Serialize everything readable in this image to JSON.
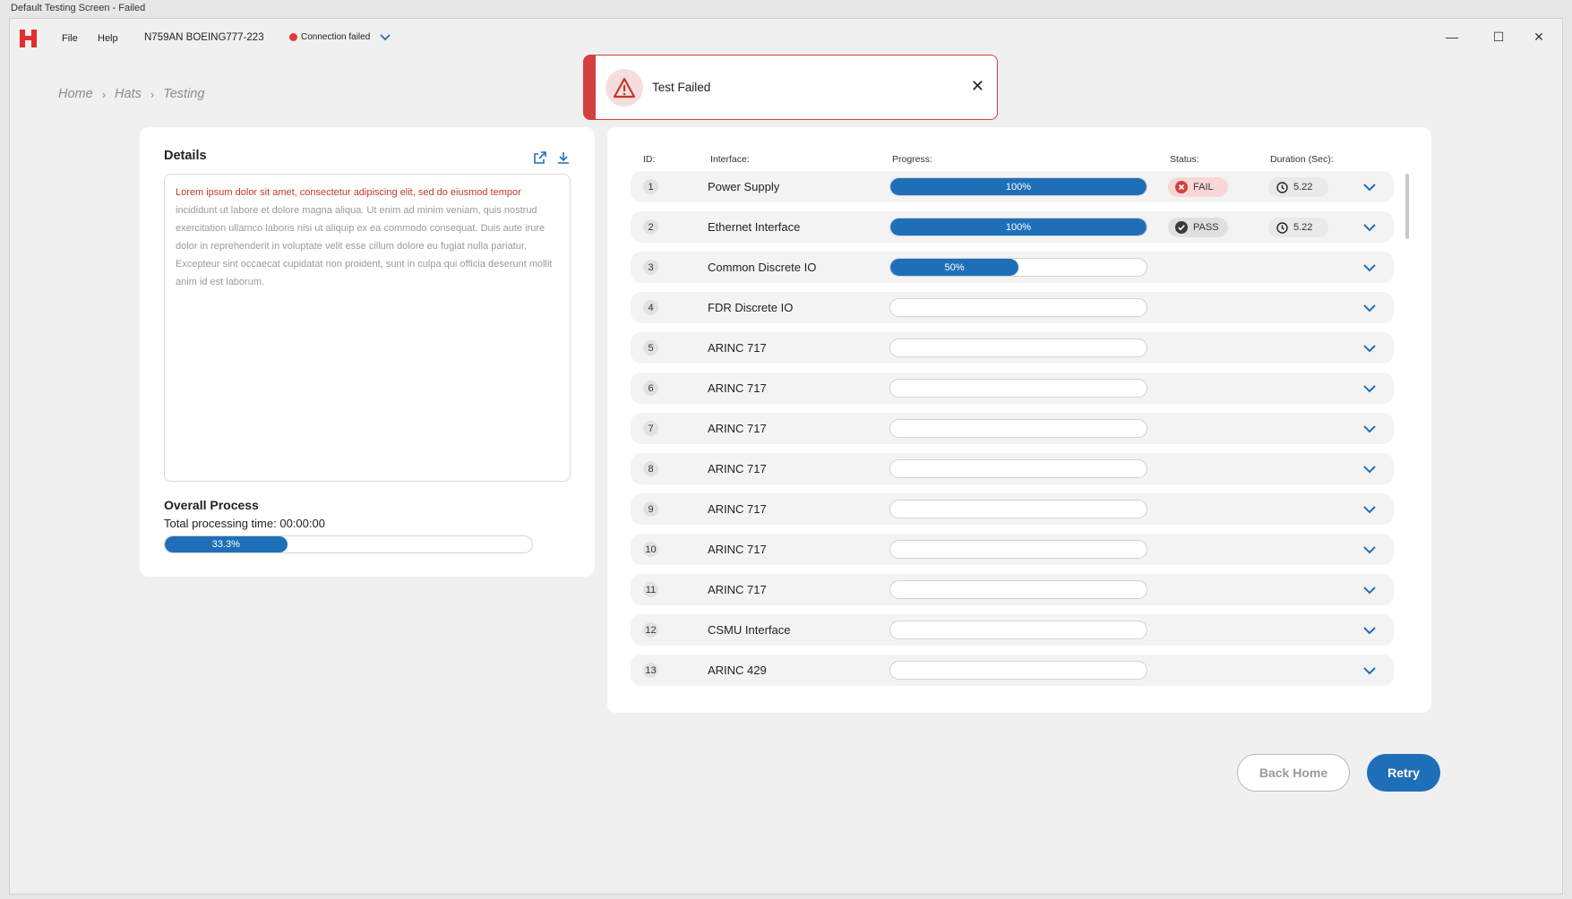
{
  "window": {
    "title": "Default Testing Screen - Failed"
  },
  "menubar": {
    "file": "File",
    "help": "Help",
    "aircraft": "N759AN BOEING777-223",
    "connection_status": "Connection failed",
    "connection_color": "#e03a3a"
  },
  "breadcrumb": {
    "items": [
      "Home",
      "Hats",
      "Testing"
    ]
  },
  "toast": {
    "message": "Test Failed",
    "color": "#d43f3f"
  },
  "details": {
    "title": "Details",
    "highlight_text": "Lorem ipsum dolor sit amet, consectetur adipiscing elit, sed do eiusmod tempor",
    "body_text": " incididunt ut labore et dolore magna aliqua. Ut enim ad minim veniam, quis nostrud exercitation ullamco laboris nisi ut aliquip ex ea commodo consequat. Duis aute irure dolor in reprehenderit in voluptate velit esse cillum dolore eu fugiat nulla pariatur. Excepteur sint occaecat cupidatat non proident, sunt in culpa qui officia deserunt mollit anim id est laborum.",
    "overall_title": "Overall Process",
    "processing_time": "Total processing time: 00:00:00",
    "overall_progress": 33.3,
    "overall_progress_label": "33.3%"
  },
  "table": {
    "headers": {
      "id": "ID:",
      "interface": "Interface:",
      "progress": "Progress:",
      "status": "Status:",
      "duration": "Duration (Sec):"
    },
    "rows": [
      {
        "id": "1",
        "interface": "Power Supply",
        "progress": 100,
        "progress_label": "100%",
        "status": "FAIL",
        "duration": "5.22"
      },
      {
        "id": "2",
        "interface": "Ethernet Interface",
        "progress": 100,
        "progress_label": "100%",
        "status": "PASS",
        "duration": "5.22"
      },
      {
        "id": "3",
        "interface": "Common Discrete IO",
        "progress": 50,
        "progress_label": "50%",
        "status": "",
        "duration": ""
      },
      {
        "id": "4",
        "interface": "FDR Discrete IO",
        "progress": 0,
        "progress_label": "",
        "status": "",
        "duration": ""
      },
      {
        "id": "5",
        "interface": "ARINC 717",
        "progress": 0,
        "progress_label": "",
        "status": "",
        "duration": ""
      },
      {
        "id": "6",
        "interface": "ARINC 717",
        "progress": 0,
        "progress_label": "",
        "status": "",
        "duration": ""
      },
      {
        "id": "7",
        "interface": "ARINC 717",
        "progress": 0,
        "progress_label": "",
        "status": "",
        "duration": ""
      },
      {
        "id": "8",
        "interface": "ARINC 717",
        "progress": 0,
        "progress_label": "",
        "status": "",
        "duration": ""
      },
      {
        "id": "9",
        "interface": "ARINC 717",
        "progress": 0,
        "progress_label": "",
        "status": "",
        "duration": ""
      },
      {
        "id": "10",
        "interface": "ARINC 717",
        "progress": 0,
        "progress_label": "",
        "status": "",
        "duration": ""
      },
      {
        "id": "11",
        "interface": "ARINC 717",
        "progress": 0,
        "progress_label": "",
        "status": "",
        "duration": ""
      },
      {
        "id": "12",
        "interface": "CSMU Interface",
        "progress": 0,
        "progress_label": "",
        "status": "",
        "duration": ""
      },
      {
        "id": "13",
        "interface": "ARINC 429",
        "progress": 0,
        "progress_label": "",
        "status": "",
        "duration": ""
      }
    ]
  },
  "actions": {
    "back_home": "Back Home",
    "retry": "Retry"
  },
  "colors": {
    "accent": "#1f6fb8",
    "brand": "#e32d2d",
    "fail": "#d43f3f"
  }
}
